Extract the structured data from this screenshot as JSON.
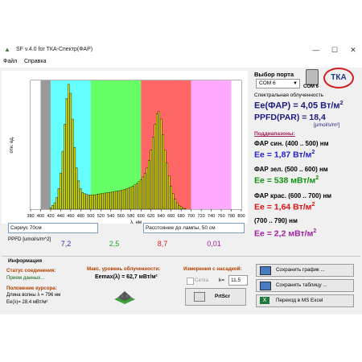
{
  "window": {
    "title": "SF v.4.0 for ТКА-Спектр(ФАР)",
    "minimize": "—",
    "maximize": "☐",
    "close": "✕"
  },
  "menu": {
    "file": "Файл",
    "help": "Справка"
  },
  "port": {
    "label": "Выбор порта",
    "selected": "COM 6",
    "device_label": "COM 6",
    "logo": "ТКА"
  },
  "chart_data": {
    "type": "bar",
    "ylabel": "отн. ед.",
    "xlabel": "λ, нм",
    "xlim": [
      380,
      800
    ],
    "ylim": [
      0,
      1
    ],
    "x_ticks": [
      "380",
      "400",
      "420",
      "440",
      "460",
      "480",
      "500",
      "520",
      "540",
      "560",
      "580",
      "600",
      "620",
      "640",
      "660",
      "680",
      "700",
      "720",
      "740",
      "760",
      "780",
      "800"
    ],
    "bands": [
      {
        "from": 380,
        "to": 400,
        "color": "#ffffff"
      },
      {
        "from": 400,
        "to": 420,
        "color": "#9a9a9a"
      },
      {
        "from": 420,
        "to": 500,
        "color": "#66ffff"
      },
      {
        "from": 500,
        "to": 600,
        "color": "#66ff66"
      },
      {
        "from": 600,
        "to": 700,
        "color": "#ff6666"
      },
      {
        "from": 700,
        "to": 780,
        "color": "#ffaaff"
      },
      {
        "from": 780,
        "to": 800,
        "color": "#ffffff"
      }
    ],
    "x": [
      420,
      424,
      428,
      432,
      436,
      440,
      444,
      448,
      452,
      456,
      460,
      464,
      468,
      472,
      476,
      480,
      484,
      488,
      492,
      496,
      500,
      504,
      508,
      512,
      516,
      520,
      524,
      528,
      532,
      536,
      540,
      544,
      548,
      552,
      556,
      560,
      564,
      568,
      572,
      576,
      580,
      584,
      588,
      592,
      596,
      600,
      604,
      608,
      612,
      616,
      620,
      624,
      628,
      632,
      636,
      640,
      644,
      648,
      652,
      656,
      660,
      664,
      668,
      672,
      676,
      680,
      684,
      688
    ],
    "values": [
      0.01,
      0.03,
      0.05,
      0.09,
      0.16,
      0.28,
      0.45,
      0.66,
      0.86,
      0.97,
      0.9,
      0.7,
      0.48,
      0.32,
      0.22,
      0.16,
      0.13,
      0.12,
      0.115,
      0.11,
      0.11,
      0.11,
      0.112,
      0.115,
      0.118,
      0.12,
      0.122,
      0.125,
      0.128,
      0.13,
      0.132,
      0.135,
      0.138,
      0.14,
      0.143,
      0.146,
      0.15,
      0.155,
      0.16,
      0.165,
      0.172,
      0.18,
      0.19,
      0.2,
      0.215,
      0.23,
      0.25,
      0.28,
      0.32,
      0.38,
      0.46,
      0.56,
      0.66,
      0.74,
      0.76,
      0.7,
      0.58,
      0.46,
      0.36,
      0.26,
      0.18,
      0.12,
      0.08,
      0.05,
      0.03,
      0.02,
      0.01,
      0.005
    ]
  },
  "sample": {
    "name": "Сириус 70см",
    "distance": "Расстояние до лампы, 50 см"
  },
  "ppfd_row": {
    "label": "PPFD [umol/s/m^2]",
    "values": [
      "7,2",
      "2,5",
      "8,7",
      "0,01"
    ],
    "colors": [
      "#3030a0",
      "#20a020",
      "#d02020",
      "#a020a0"
    ]
  },
  "info": {
    "title": "Информация",
    "conn_label": "Статус соединения:",
    "conn_value": "Прием данных...",
    "cursor_label": "Положение курсора:",
    "wavelength_line": "Длина волны λ = 796 нм",
    "ee_line": "Ee(λ)= 28,4 мВт/м²",
    "max_label": "Макс. уровень облученности:",
    "max_value": "Eemax(λ) = 62,7 мВт/м²"
  },
  "measure": {
    "title": "Измерения с насадкой:",
    "grid_label": "Сетка",
    "k_label": "k=",
    "k_value": "11,5",
    "prtscr": "PrtScr"
  },
  "buttons": {
    "save_chart": "Сохранить график ...",
    "save_table": "Сохранить таблицу ...",
    "excel": "Переход в MS Excel"
  },
  "results": {
    "header": "Спектральная облученность",
    "fap": "Ee(ФАР) = 4,05 Вт/м",
    "fap_sup": "2",
    "ppfd": "PPFD(PAR) = 18,4",
    "ppfd_unit": "[µmol/s/m²]",
    "subranges": "Поддиапазоны:",
    "blue_label": "ФАР син. (400 .. 500) нм",
    "blue_value": "Ee = 1,87 Вт/м",
    "green_label": "ФАР зел. (500 .. 600) нм",
    "green_value": "Ee = 538 мВт/м",
    "red_label": "ФАР крас. (600 .. 700) нм",
    "red_value": "Ee = 1,64 Вт/м",
    "far_label": "(700 .. 790) нм",
    "far_value": "Ee = 2,2 мВт/м",
    "sup2": "2"
  }
}
